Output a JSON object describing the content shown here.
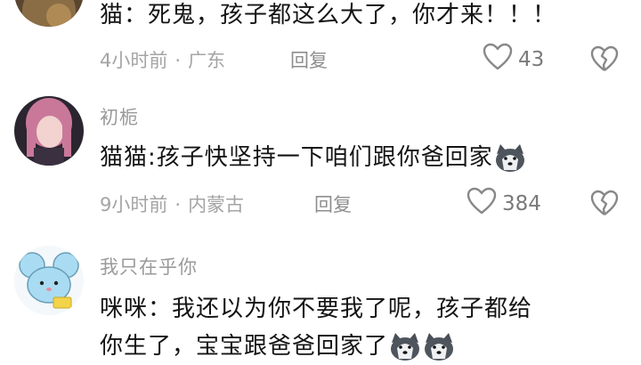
{
  "comments": [
    {
      "username": "",
      "text": "猫：死鬼，孩子都这么大了，你才来！！！",
      "time": "4小时前",
      "location": "广东",
      "reply_label": "回复",
      "likes": "43",
      "icons": {
        "like": "heart-outline-icon",
        "dislike": "broken-heart-icon"
      }
    },
    {
      "username": "初栀",
      "text": "猫猫:孩子快坚持一下咱们跟你爸回家",
      "time": "9小时前",
      "location": "内蒙古",
      "reply_label": "回复",
      "likes": "384",
      "icons": {
        "like": "heart-outline-icon",
        "dislike": "broken-heart-icon",
        "emoji": "husky-dog-emoji-icon"
      }
    },
    {
      "username": "我只在乎你",
      "text_line1": "咪咪：我还以为你不要我了呢，孩子都给",
      "text_line2": "你生了，宝宝跟爸爸回家了",
      "icons": {
        "avatar": "cartoon-mouse-avatar",
        "emoji": "husky-dog-emoji-icon"
      }
    }
  ],
  "colors": {
    "text": "#141414",
    "meta": "#a4a4a4",
    "username": "#9a9a9a",
    "background": "#ffffff"
  }
}
